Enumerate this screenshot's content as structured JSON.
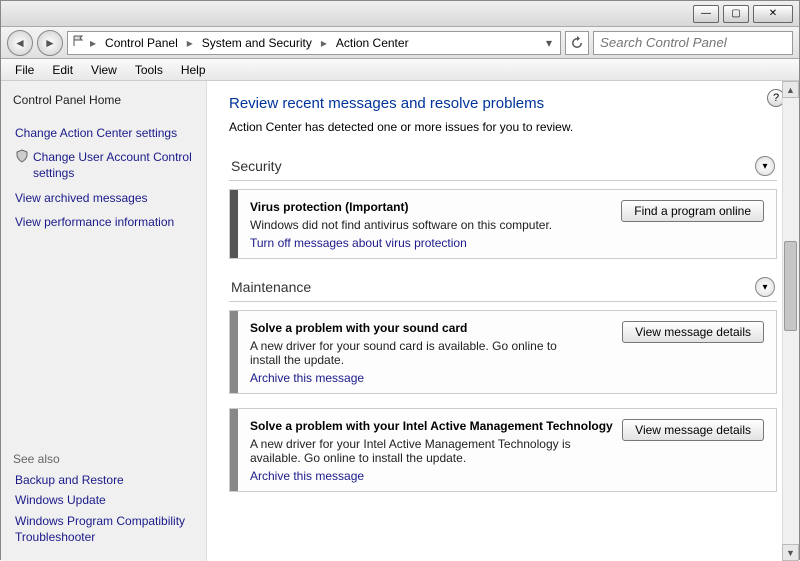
{
  "window": {
    "min": "—",
    "max": "▢",
    "close": "✕"
  },
  "breadcrumb": {
    "seg1": "Control Panel",
    "seg2": "System and Security",
    "seg3": "Action Center"
  },
  "search": {
    "placeholder": "Search Control Panel"
  },
  "menu": {
    "file": "File",
    "edit": "Edit",
    "view": "View",
    "tools": "Tools",
    "help": "Help"
  },
  "sidebar": {
    "home": "Control Panel Home",
    "links": {
      "l0": "Change Action Center settings",
      "l1": "Change User Account Control settings",
      "l2": "View archived messages",
      "l3": "View performance information"
    },
    "seealso_head": "See also",
    "seealso": {
      "s0": "Backup and Restore",
      "s1": "Windows Update",
      "s2": "Windows Program Compatibility Troubleshooter"
    }
  },
  "content": {
    "heading": "Review recent messages and resolve problems",
    "intro": "Action Center has detected one or more issues for you to review.",
    "security_title": "Security",
    "maintenance_title": "Maintenance",
    "sec_card": {
      "title": "Virus protection  (Important)",
      "desc": "Windows did not find antivirus software on this computer.",
      "link": "Turn off messages about virus protection",
      "button": "Find a program online"
    },
    "m1": {
      "title": "Solve a problem with your sound card",
      "desc": "A new driver for your sound card is available. Go online to install the update.",
      "link": "Archive this message",
      "button": "View message details"
    },
    "m2": {
      "title": "Solve a problem with your Intel Active Management Technology",
      "desc": "A new driver for your Intel Active Management Technology is available. Go online to install the update.",
      "link": "Archive this message",
      "button": "View message details"
    }
  }
}
